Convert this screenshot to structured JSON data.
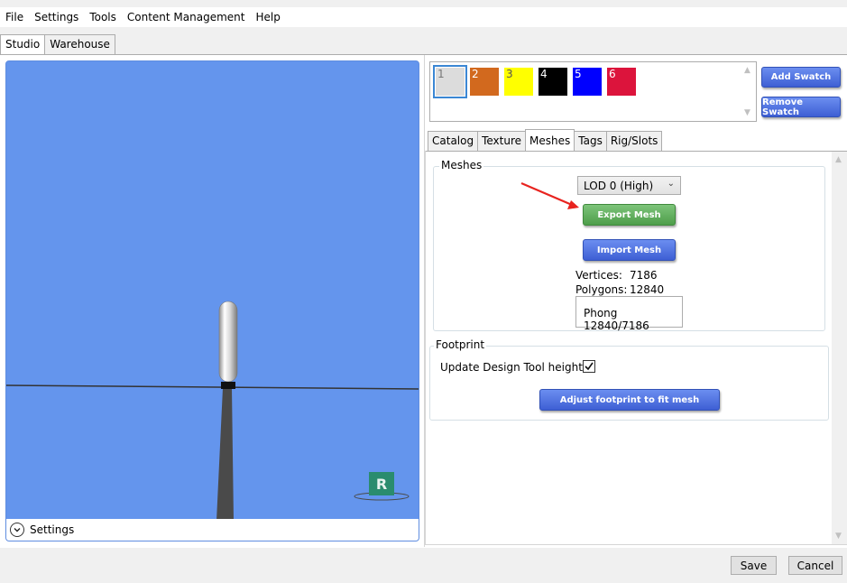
{
  "menu": [
    "File",
    "Settings",
    "Tools",
    "Content Management",
    "Help"
  ],
  "main_tabs": [
    "Studio",
    "Warehouse"
  ],
  "viewport": {
    "settings_label": "Settings",
    "gizmo_label": "R",
    "colors": {
      "background": "#6495ed",
      "gizmo": "#2a8c6e"
    }
  },
  "swatches": [
    {
      "label": "1",
      "color": "#dcdcdc",
      "text_color": "#777777",
      "selected": true
    },
    {
      "label": "2",
      "color": "#d2691e",
      "text_color": "#ffffff",
      "selected": false
    },
    {
      "label": "3",
      "color": "#ffff00",
      "text_color": "#555555",
      "selected": false
    },
    {
      "label": "4",
      "color": "#000000",
      "text_color": "#ffffff",
      "selected": false
    },
    {
      "label": "5",
      "color": "#0000ff",
      "text_color": "#ffffff",
      "selected": false
    },
    {
      "label": "6",
      "color": "#dc143c",
      "text_color": "#ffffff",
      "selected": false
    }
  ],
  "swatch_buttons": {
    "add": "Add Swatch",
    "remove": "Remove Swatch"
  },
  "sub_tabs": [
    "Catalog",
    "Texture",
    "Meshes",
    "Tags",
    "Rig/Slots"
  ],
  "meshes": {
    "group_title": "Meshes",
    "lod_selected": "LOD 0 (High)",
    "export_label": "Export Mesh",
    "import_label": "Import Mesh",
    "vertices_label": "Vertices:",
    "vertices_value": "7186",
    "polygons_label": "Polygons:",
    "polygons_value": "12840",
    "phong_text": "Phong 12840/7186"
  },
  "footprint": {
    "group_title": "Footprint",
    "update_label": "Update Design Tool height",
    "update_checked": true,
    "adjust_label": "Adjust footprint to fit mesh"
  },
  "bottom": {
    "save": "Save",
    "cancel": "Cancel"
  }
}
